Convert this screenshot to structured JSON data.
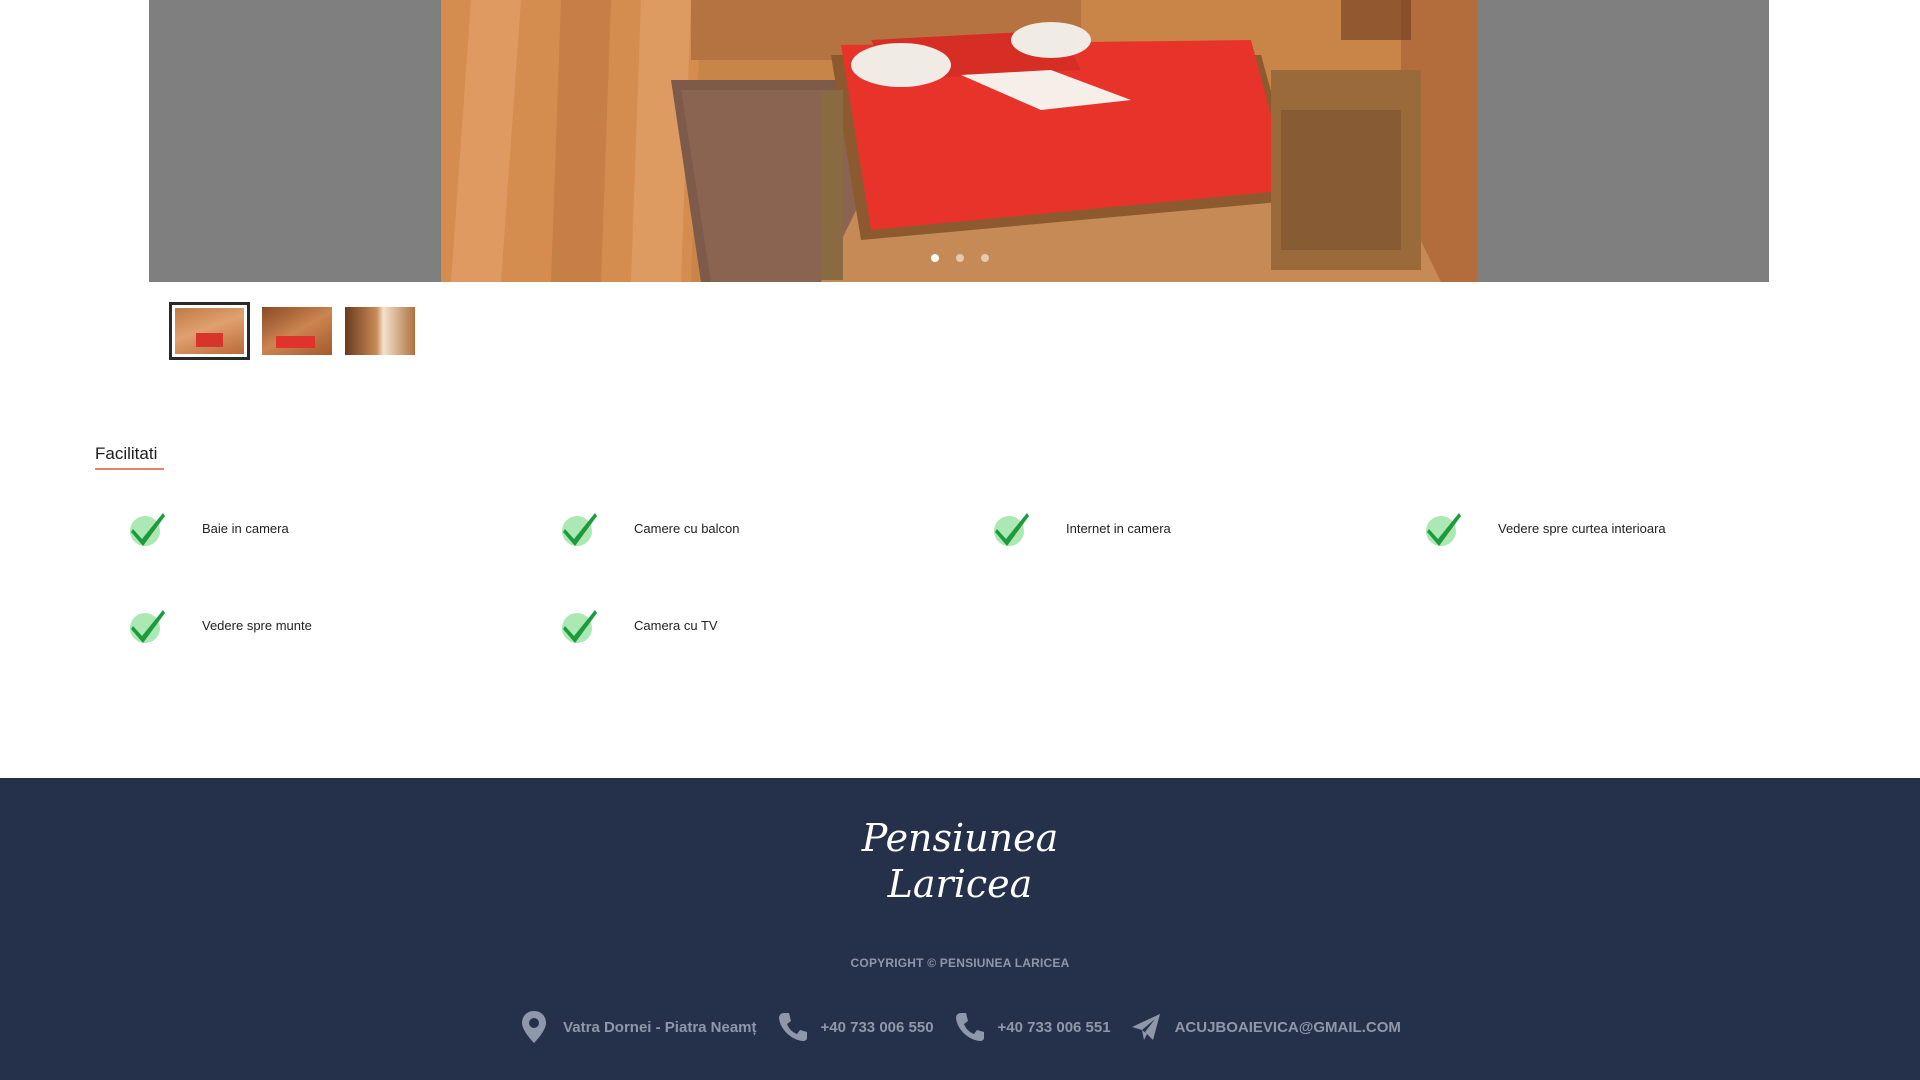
{
  "gallery": {
    "slides": 3,
    "active_slide": 1,
    "thumbnails": [
      {
        "name": "room-bed-thumb"
      },
      {
        "name": "room-dining-thumb"
      },
      {
        "name": "room-bathroom-thumb"
      }
    ]
  },
  "facilities": {
    "title": "Facilitati",
    "items": [
      {
        "label": "Baie in camera"
      },
      {
        "label": "Camere cu balcon"
      },
      {
        "label": "Internet in camera"
      },
      {
        "label": "Vedere spre curtea interioara"
      },
      {
        "label": "Vedere spre munte"
      },
      {
        "label": "Camera cu TV"
      }
    ]
  },
  "footer": {
    "logo_line1": "Pensiunea",
    "logo_line2": "Laricea",
    "copyright": "COPYRIGHT © PENSIUNEA LARICEA",
    "contacts": {
      "address": "Vatra Dornei - Piatra Neamț",
      "phone1": "+40 733 006 550",
      "phone2": "+40 733 006 551",
      "email": "ACUJBOAIEVICA@GMAIL.COM"
    }
  },
  "colors": {
    "gallery_bg": "#7f7f7f",
    "accent_underline": "#e4856a",
    "check_green": "#1d9b3c",
    "footer_bg": "#25314a",
    "footer_text": "#8f98aa"
  },
  "icons": {
    "check": "check-icon",
    "address": "location-pin-icon",
    "phone": "phone-icon",
    "email": "paper-plane-icon"
  }
}
